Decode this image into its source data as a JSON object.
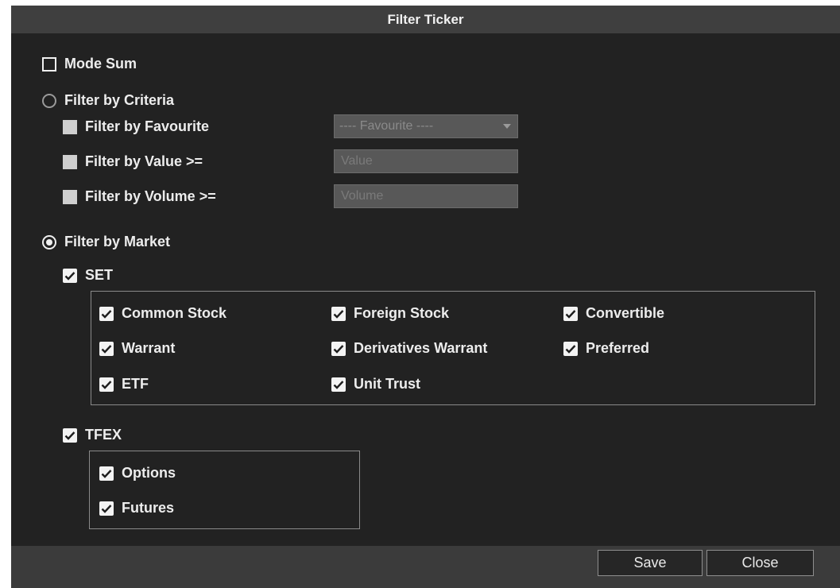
{
  "dialog": {
    "title": "Filter Ticker"
  },
  "mode_sum": {
    "label": "Mode Sum",
    "checked": false
  },
  "criteria": {
    "label": "Filter by Criteria",
    "selected": false,
    "favourite": {
      "label": "Filter by Favourite",
      "checked": false,
      "select_value": "---- Favourite ----"
    },
    "value": {
      "label": "Filter by Value >=",
      "checked": false,
      "placeholder": "Value"
    },
    "volume": {
      "label": "Filter by Volume >=",
      "checked": false,
      "placeholder": "Volume"
    }
  },
  "market": {
    "label": "Filter by Market",
    "selected": true,
    "set": {
      "label": "SET",
      "checked": true,
      "items": [
        {
          "label": "Common Stock",
          "checked": true
        },
        {
          "label": "Foreign Stock",
          "checked": true
        },
        {
          "label": "Convertible",
          "checked": true
        },
        {
          "label": "Warrant",
          "checked": true
        },
        {
          "label": "Derivatives Warrant",
          "checked": true
        },
        {
          "label": "Preferred",
          "checked": true
        },
        {
          "label": "ETF",
          "checked": true
        },
        {
          "label": "Unit Trust",
          "checked": true
        }
      ]
    },
    "tfex": {
      "label": "TFEX",
      "checked": true,
      "items": [
        {
          "label": "Options",
          "checked": true
        },
        {
          "label": "Futures",
          "checked": true
        }
      ]
    }
  },
  "footer": {
    "save_label": "Save",
    "close_label": "Close"
  },
  "colors": {
    "background": "#222222",
    "title_bar": "#3f3f3f",
    "footer": "#3b3b3b",
    "input_bg": "#585858"
  }
}
